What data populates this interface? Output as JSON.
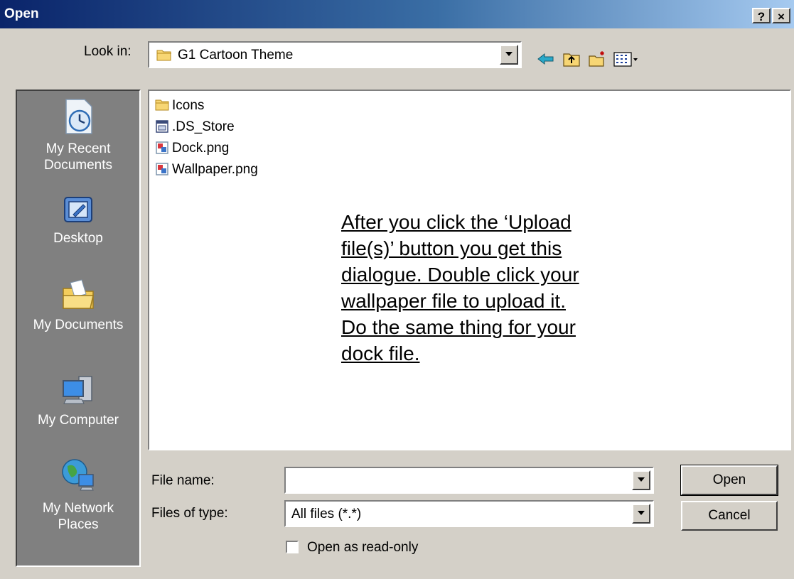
{
  "window": {
    "title": "Open",
    "help_button": "?",
    "close_button": "×"
  },
  "look_in": {
    "label": "Look in:",
    "value": "G1 Cartoon Theme"
  },
  "toolbar": {
    "icons": [
      "back-arrow-icon",
      "up-folder-icon",
      "new-folder-icon",
      "views-menu-icon"
    ]
  },
  "places": [
    {
      "label_line1": "My Recent",
      "label_line2": "Documents",
      "icon": "recent-documents-icon"
    },
    {
      "label_line1": "Desktop",
      "label_line2": "",
      "icon": "desktop-icon"
    },
    {
      "label_line1": "My Documents",
      "label_line2": "",
      "icon": "my-documents-icon"
    },
    {
      "label_line1": "My Computer",
      "label_line2": "",
      "icon": "my-computer-icon"
    },
    {
      "label_line1": "My Network",
      "label_line2": "Places",
      "icon": "network-places-icon"
    }
  ],
  "files": [
    {
      "name": "Icons",
      "icon": "folder-icon"
    },
    {
      "name": ".DS_Store",
      "icon": "generic-file-icon"
    },
    {
      "name": "Dock.png",
      "icon": "image-file-icon"
    },
    {
      "name": "Wallpaper.png",
      "icon": "image-file-icon"
    }
  ],
  "annotation": {
    "lines": [
      "After you click the ‘Upload",
      "file(s)’ button you get this",
      "dialogue.  Double click your",
      "wallpaper file to upload it.",
      "Do the same thing for your",
      "dock file."
    ]
  },
  "file_name": {
    "label": "File name:",
    "value": ""
  },
  "file_type": {
    "label": "Files of type:",
    "value": "All files (*.*)"
  },
  "read_only": {
    "label": "Open as read-only",
    "checked": false
  },
  "buttons": {
    "open": "Open",
    "cancel": "Cancel"
  },
  "colors": {
    "title_start": "#0a246a",
    "title_end": "#a6caf0",
    "face": "#d4d0c8",
    "places_bg": "#808080"
  }
}
